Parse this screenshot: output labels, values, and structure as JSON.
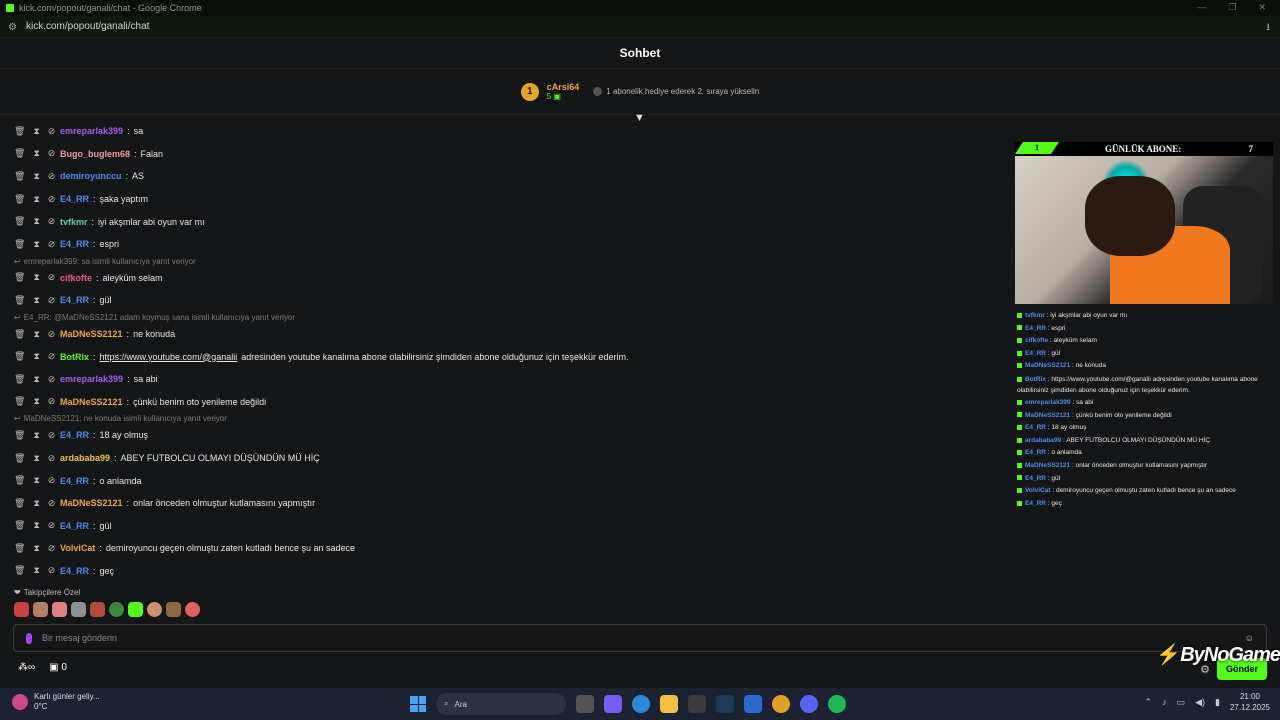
{
  "window": {
    "title": "kick.com/popout/ganali/chat - Google Chrome",
    "url": "kick.com/popout/ganali/chat"
  },
  "chat": {
    "header": "Sohbet",
    "input_placeholder": "Bir mesaj gönderin",
    "send_label": "Gönder",
    "pinned_label": "Takipçilere Özel",
    "infinity": "∞",
    "gift_count": "0"
  },
  "leaderboard": {
    "rank": "1",
    "user": "cArsi64",
    "count": "5",
    "message": "1 abonelik hediye ederek 2. sıraya yükselin"
  },
  "colors": {
    "kick_green": "#53fc18",
    "purple": "#a742f5",
    "blue": "#4a8cf0",
    "gold": "#f3a63c"
  },
  "messages": [
    {
      "user": "emreparlak399",
      "color": "#a45cf2",
      "text": "sa"
    },
    {
      "user": "Bugo_buglem68",
      "color": "#f29b9b",
      "text": "Falan"
    },
    {
      "user": "demiroyunccu",
      "color": "#4a8cf0",
      "text": "AS"
    },
    {
      "user": "E4_RR",
      "color": "#4a8cf0",
      "text": "şaka yaptım"
    },
    {
      "user": "tvfkmr",
      "color": "#5ccfa8",
      "text": "iyi akşmlar abi oyun var mı"
    },
    {
      "user": "E4_RR",
      "color": "#4a8cf0",
      "text": "espri"
    },
    {
      "reply": "emreparlak399: sa isimli kullanıcıya yanıt veriyor",
      "user": "cifkofte",
      "color": "#f25c8c",
      "text": "aleyküm selam"
    },
    {
      "user": "E4_RR",
      "color": "#4a8cf0",
      "text": "gül"
    },
    {
      "reply": "E4_RR: @MaDNeSS2121 adam koymuş sana isimli kullanıcıya yanıt veriyor",
      "user": "MaDNeSS2121",
      "color": "#f3a63c",
      "text": "ne konuda"
    },
    {
      "user": "BotRix",
      "color": "#53fc18",
      "text": "adresinden youtube kanalıma abone olabilirsiniz şimdiden abone olduğunuz için teşekkür ederim.",
      "link": "https://www.youtube.com/@ganalii"
    },
    {
      "user": "emreparlak399",
      "color": "#a45cf2",
      "text": "sa abi"
    },
    {
      "user": "MaDNeSS2121",
      "color": "#f3a63c",
      "text": "çünkü benim oto yenileme değildi"
    },
    {
      "reply": "MaDNeSS2121: ne konuda isimli kullanıcıya yanıt veriyor",
      "user": "E4_RR",
      "color": "#4a8cf0",
      "text": "18 ay olmuş"
    },
    {
      "user": "ardababa99",
      "color": "#f3c23c",
      "text": "ABEY FUTBOLCU OLMAYI DÜŞÜNDÜN MÜ HİÇ"
    },
    {
      "user": "E4_RR",
      "color": "#4a8cf0",
      "text": "o anlamda"
    },
    {
      "user": "MaDNeSS2121",
      "color": "#f3a63c",
      "text": "onlar önceden olmuştur kutlamasını yapmıştır"
    },
    {
      "user": "E4_RR",
      "color": "#4a8cf0",
      "text": "gül"
    },
    {
      "user": "VolviCat",
      "color": "#f3a63c",
      "text": "demiroyuncu geçen olmuştu zaten kutladı bence şu an sadece"
    },
    {
      "user": "E4_RR",
      "color": "#4a8cf0",
      "text": "geç"
    }
  ],
  "overlay": {
    "tag": "1",
    "title": "GÜNLÜK ABONE:",
    "count": "7",
    "lines": [
      {
        "user": "tvfkmr",
        "text": "iyi akşmlar abi oyun var mı"
      },
      {
        "user": "E4_RR",
        "text": "espri"
      },
      {
        "user": "cifkofte",
        "text": "aleyküm selam"
      },
      {
        "user": "E4_RR",
        "text": "gül"
      },
      {
        "user": "MaDNeSS2121",
        "text": "ne konuda"
      },
      {
        "user": "BotRix",
        "text": "https://www.youtube.com/@ganalii adresinden youtube kanalıma abone olabilirsiniz şimdiden abone olduğunuz için teşekkür ederim."
      },
      {
        "user": "emreparlak399",
        "text": "sa abi"
      },
      {
        "user": "MaDNeSS2121",
        "text": "çünkü benim oto yenileme değildi"
      },
      {
        "user": "E4_RR",
        "text": "18 ay olmuş"
      },
      {
        "user": "ardababa99",
        "text": "ABEY FUTBOLCU OLMAYI DÜŞÜNDÜN MÜ HİÇ"
      },
      {
        "user": "E4_RR",
        "text": "o anlamda"
      },
      {
        "user": "MaDNeSS2121",
        "text": "onlar önceden olmuştur kutlamasını yapmıştır"
      },
      {
        "user": "E4_RR",
        "text": "gül"
      },
      {
        "user": "VolviCat",
        "text": "demiroyuncu geçen olmuştu zaten kutladı bence şu an sadece"
      },
      {
        "user": "E4_RR",
        "text": "geç"
      }
    ]
  },
  "logo": {
    "text": "ByNoGame"
  },
  "taskbar": {
    "weather_title": "Karlı günler geliy...",
    "weather_temp": "0°C",
    "search": "Ara",
    "time": "21:00",
    "date": "27.12.2025"
  }
}
